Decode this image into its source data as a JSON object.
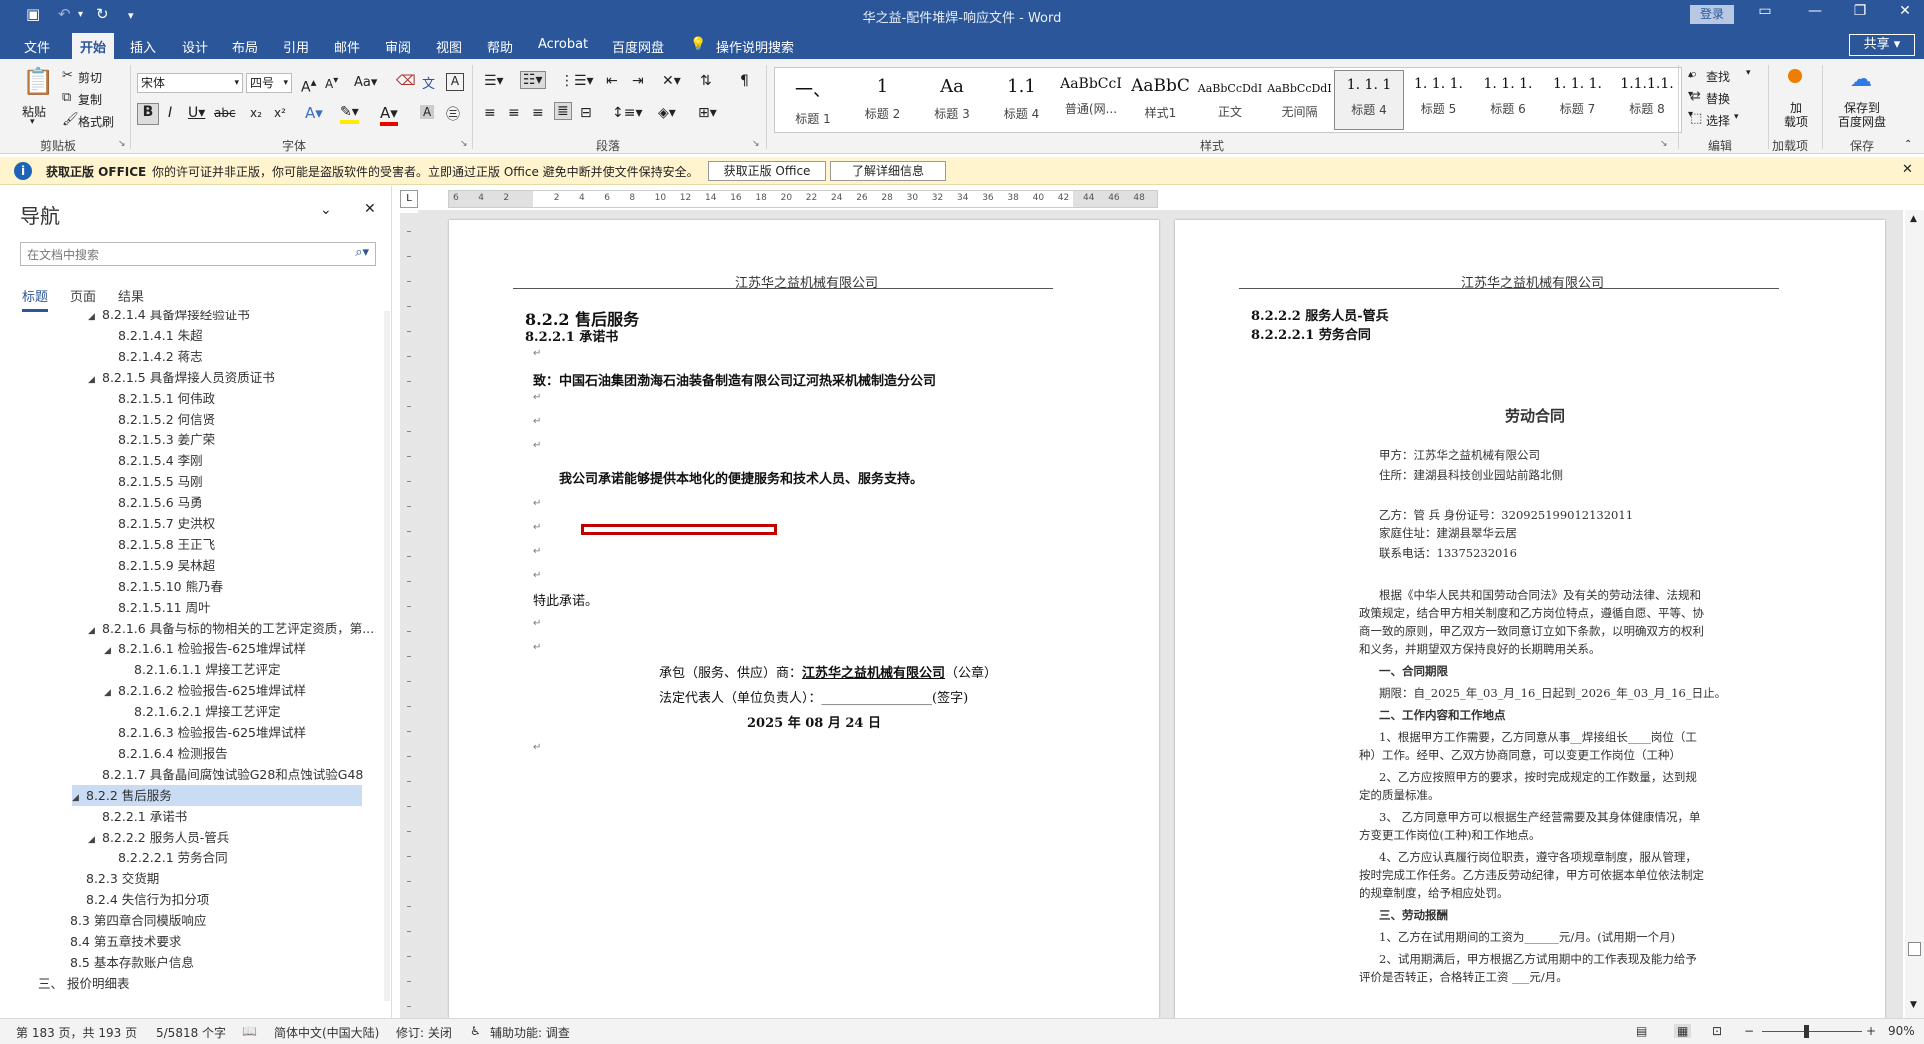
{
  "titlebar": {
    "title": "华之益-配件堆焊-响应文件  -  Word",
    "login": "登录"
  },
  "menu": [
    "文件",
    "开始",
    "插入",
    "设计",
    "布局",
    "引用",
    "邮件",
    "审阅",
    "视图",
    "帮助",
    "Acrobat",
    "百度网盘"
  ],
  "tell_me": "操作说明搜索",
  "share": "共享",
  "ribbon": {
    "clipboard": {
      "paste": "粘贴",
      "cut": "剪切",
      "copy": "复制",
      "painter": "格式刷",
      "label": "剪贴板"
    },
    "font": {
      "name": "宋体",
      "size": "四号",
      "label": "字体"
    },
    "paragraph": {
      "label": "段落"
    },
    "styles": {
      "label": "样式",
      "items": [
        {
          "sample": "一、",
          "name": "标题 1"
        },
        {
          "sample": "1",
          "name": "标题 2"
        },
        {
          "sample": "Aa",
          "name": "标题 3"
        },
        {
          "sample": "1.1",
          "name": "标题 4"
        },
        {
          "sample": "AaBbCcI",
          "name": "普通(网..."
        },
        {
          "sample": "AaBbC",
          "name": "样式1"
        },
        {
          "sample": "AaBbCcDdI",
          "name": "正文"
        },
        {
          "sample": "AaBbCcDdI",
          "name": "无间隔"
        },
        {
          "sample": "1. 1. 1",
          "name": "标题 4"
        },
        {
          "sample": "1. 1. 1.",
          "name": "标题 5"
        },
        {
          "sample": "1. 1. 1.",
          "name": "标题 6"
        },
        {
          "sample": "1. 1. 1.",
          "name": "标题 7"
        },
        {
          "sample": "1.1.1.1.",
          "name": "标题 8"
        }
      ]
    },
    "editing": {
      "find": "查找",
      "replace": "替换",
      "select": "选择",
      "label": "编辑"
    },
    "addins": {
      "btn": "加\n载项",
      "label": "加载项"
    },
    "save": {
      "btn": "保存到\n百度网盘",
      "label": "保存"
    }
  },
  "warning": {
    "title": "获取正版 OFFICE",
    "text": "你的许可证并非正版，你可能是盗版软件的受害者。立即通过正版 Office 避免中断并使文件保持安全。",
    "btn1": "获取正版 Office",
    "btn2": "了解详细信息"
  },
  "nav": {
    "title": "导航",
    "search_placeholder": "在文档中搜索",
    "tabs": [
      "标题",
      "页面",
      "结果"
    ],
    "items": [
      {
        "t": "8.2.1.4 具备焊接经验证书",
        "lv": 3,
        "tri": "◢"
      },
      {
        "t": "8.2.1.4.1 朱超",
        "lv": 4
      },
      {
        "t": "8.2.1.4.2 蒋志",
        "lv": 4
      },
      {
        "t": "8.2.1.5 具备焊接人员资质证书",
        "lv": 3,
        "tri": "◢"
      },
      {
        "t": "8.2.1.5.1 何伟政",
        "lv": 4
      },
      {
        "t": "8.2.1.5.2 何信贤",
        "lv": 4
      },
      {
        "t": "8.2.1.5.3 姜广荣",
        "lv": 4
      },
      {
        "t": "8.2.1.5.4 李刚",
        "lv": 4
      },
      {
        "t": "8.2.1.5.5 马刚",
        "lv": 4
      },
      {
        "t": "8.2.1.5.6 马勇",
        "lv": 4
      },
      {
        "t": "8.2.1.5.7 史洪权",
        "lv": 4
      },
      {
        "t": "8.2.1.5.8 王正飞",
        "lv": 4
      },
      {
        "t": "8.2.1.5.9 吴林超",
        "lv": 4
      },
      {
        "t": "8.2.1.5.10 熊乃春",
        "lv": 4
      },
      {
        "t": "8.2.1.5.11 周叶",
        "lv": 4
      },
      {
        "t": "8.2.1.6 具备与标的物相关的工艺评定资质，第...",
        "lv": 3,
        "tri": "◢"
      },
      {
        "t": "8.2.1.6.1 检验报告-625堆焊试样",
        "lv": 4,
        "tri": "◢"
      },
      {
        "t": "8.2.1.6.1.1 焊接工艺评定",
        "lv": 5
      },
      {
        "t": "8.2.1.6.2 检验报告-625堆焊试样",
        "lv": 4,
        "tri": "◢"
      },
      {
        "t": "8.2.1.6.2.1 焊接工艺评定",
        "lv": 5
      },
      {
        "t": "8.2.1.6.3 检验报告-625堆焊试样",
        "lv": 4
      },
      {
        "t": "8.2.1.6.4 检测报告",
        "lv": 4
      },
      {
        "t": "8.2.1.7 具备晶间腐蚀试验G28和点蚀试验G48",
        "lv": 3
      },
      {
        "t": "8.2.2 售后服务",
        "lv": 2,
        "tri": "◢",
        "sel": true
      },
      {
        "t": "8.2.2.1 承诺书",
        "lv": 3
      },
      {
        "t": "8.2.2.2 服务人员-管兵",
        "lv": 3,
        "tri": "◢"
      },
      {
        "t": "8.2.2.2.1 劳务合同",
        "lv": 4
      },
      {
        "t": "8.2.3 交货期",
        "lv": 2
      },
      {
        "t": "8.2.4 失信行为扣分项",
        "lv": 2
      },
      {
        "t": "8.3 第四章合同模版响应",
        "lv": 1
      },
      {
        "t": "8.4 第五章技术要求",
        "lv": 1
      },
      {
        "t": "8.5 基本存款账户信息",
        "lv": 1
      },
      {
        "t": "三、 报价明细表",
        "lv": 0
      }
    ]
  },
  "ruler": [
    "6",
    "4",
    "2",
    "",
    "2",
    "4",
    "6",
    "8",
    "10",
    "12",
    "14",
    "16",
    "18",
    "20",
    "22",
    "24",
    "26",
    "28",
    "30",
    "32",
    "34",
    "36",
    "38",
    "40",
    "42",
    "44",
    "46",
    "48"
  ],
  "page1": {
    "header": "江苏华之益机械有限公司",
    "h1": "8.2.2  售后服务",
    "h2": "8.2.2.1  承诺书",
    "to": "致：中国石油集团渤海石油装备制造有限公司辽河热采机械制造分公司",
    "body": "我公司承诺能够提供本地化的便捷服务和技术人员、服务支持。",
    "end": "特此承诺。",
    "sign1_a": "承包（服务、供应）商：",
    "sign1_b": "江苏华之益机械有限公司",
    "sign1_c": "（公章）",
    "sign2": "法定代表人（单位负责人）：_________________(签字)",
    "date": "2025 年 08 月 24 日"
  },
  "page2": {
    "header": "江苏华之益机械有限公司",
    "h1": "8.2.2.2  服务人员-管兵",
    "h2": "8.2.2.2.1 劳务合同",
    "scan": {
      "title": "劳动合同",
      "lines": [
        "甲方：江苏华之益机械有限公司",
        "住所：建湖县科技创业园站前路北侧",
        "",
        "乙方：管  兵            身份证号：320925199012132011",
        "家庭住址：建湖县翠华云居",
        "联系电话：13375232016",
        "",
        "根据《中华人民共和国劳动合同法》及有关的劳动法律、法规和",
        "政策规定，结合甲方相关制度和乙方岗位特点，遵循自愿、平等、协",
        "商一致的原则，甲乙双方一致同意订立如下条款，以明确双方的权利",
        "和义务，并期望双方保持良好的长期聘用关系。",
        "一、合同期限",
        "期限：自_2025_年_03_月_16_日起到_2026_年_03_月_16_日止。",
        "二、工作内容和工作地点",
        "1、根据甲方工作需要，乙方同意从事__焊接组长____岗位（工",
        "种）工作。经甲、乙双方协商同意，可以变更工作岗位（工种）",
        "2、乙方应按照甲方的要求，按时完成规定的工作数量，达到规",
        "定的质量标准。",
        "3、 乙方同意甲方可以根据生产经营需要及其身体健康情况，单",
        "方变更工作岗位(工种)和工作地点。",
        "4、乙方应认真履行岗位职责，遵守各项规章制度，服从管理，",
        "按时完成工作任务。乙方违反劳动纪律，甲方可依据本单位依法制定",
        "的规章制度，给予相应处罚。",
        "三、劳动报酬",
        "1、乙方在试用期间的工资为______元/月。(试用期一个月)",
        "2、试用期满后，甲方根据乙方试用期中的工作表现及能力给予",
        "评价是否转正，合格转正工资  ___元/月。"
      ]
    }
  },
  "status": {
    "page": "第 183 页，共 193 页",
    "words": "5/5818 个字",
    "lang": "简体中文(中国大陆)",
    "track": "修订: 关闭",
    "access": "辅助功能: 调查",
    "zoom": "90%"
  },
  "colors": {
    "accent": "#2b579a",
    "warn": "#fff4ce",
    "red": "#c00000"
  }
}
